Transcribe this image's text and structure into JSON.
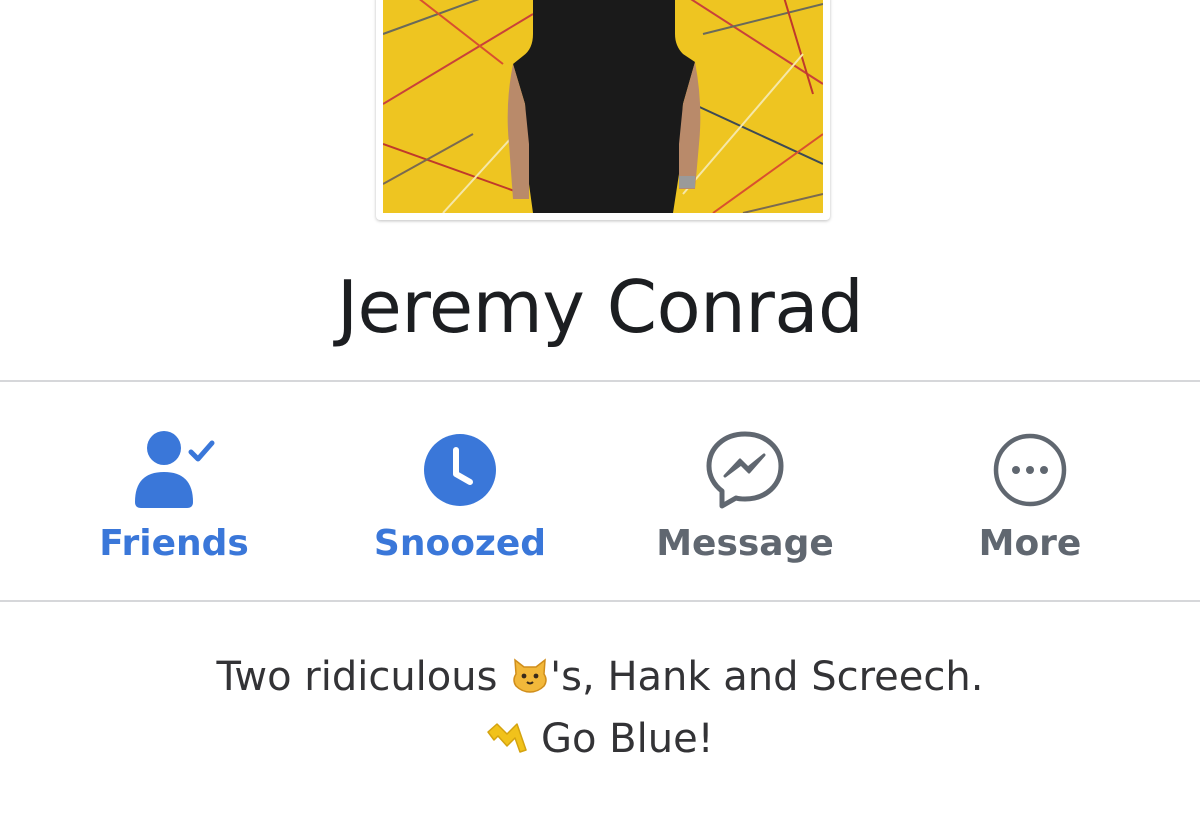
{
  "profile": {
    "name": "Jeremy Conrad",
    "photo_background": "#eec521"
  },
  "actions": [
    {
      "label": "Friends",
      "icon": "friends-check-icon",
      "color": "#3a77d9"
    },
    {
      "label": "Snoozed",
      "icon": "clock-icon",
      "color": "#3a77d9"
    },
    {
      "label": "Message",
      "icon": "messenger-icon",
      "color": "#606770"
    },
    {
      "label": "More",
      "icon": "more-dots-icon",
      "color": "#606770"
    }
  ],
  "bio": {
    "line1_before": "Two ridiculous ",
    "line1_emoji": "cat-face-emoji",
    "line1_after": "'s, Hank and Screech.",
    "line2_emoji": "block-m-emoji",
    "line2_text": " Go Blue!"
  }
}
